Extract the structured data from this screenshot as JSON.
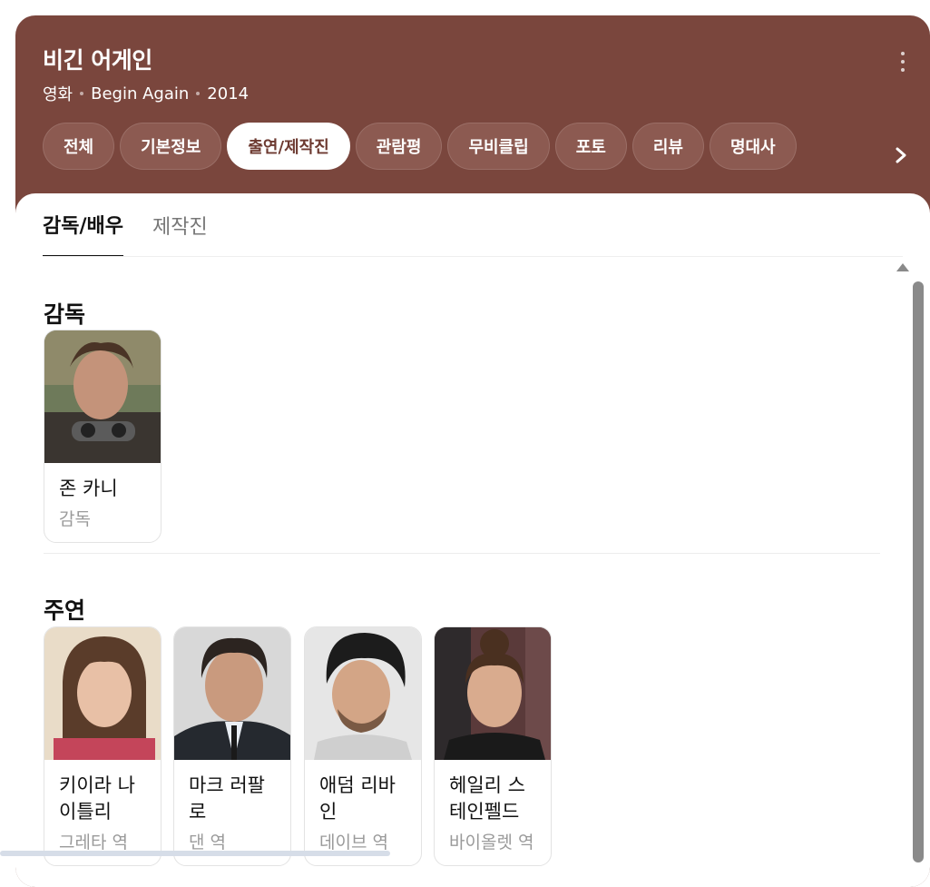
{
  "header": {
    "title": "비긴 어게인",
    "category": "영화",
    "original_title": "Begin Again",
    "year": "2014",
    "more_icon": "more-vertical-icon"
  },
  "tabs": [
    {
      "label": "전체",
      "active": false
    },
    {
      "label": "기본정보",
      "active": false
    },
    {
      "label": "출연/제작진",
      "active": true
    },
    {
      "label": "관람평",
      "active": false
    },
    {
      "label": "무비클립",
      "active": false
    },
    {
      "label": "포토",
      "active": false
    },
    {
      "label": "리뷰",
      "active": false
    },
    {
      "label": "명대사",
      "active": false
    }
  ],
  "subtabs": [
    {
      "label": "감독/배우",
      "active": true
    },
    {
      "label": "제작진",
      "active": false
    }
  ],
  "director_section": {
    "title": "감독",
    "people": [
      {
        "name": "존 카니",
        "role": "감독"
      }
    ]
  },
  "cast_section": {
    "title": "주연",
    "people": [
      {
        "name": "키이라 나이틀리",
        "role": "그레타 역"
      },
      {
        "name": "마크 러팔로",
        "role": "댄 역"
      },
      {
        "name": "애덤 리바인",
        "role": "데이브 역"
      },
      {
        "name": "헤일리 스테인펠드",
        "role": "바이올렛 역"
      }
    ]
  },
  "colors": {
    "header_bg": "#7a463d",
    "tab_bg": "#8c5a51",
    "active_tab_text": "#6d3a31"
  }
}
